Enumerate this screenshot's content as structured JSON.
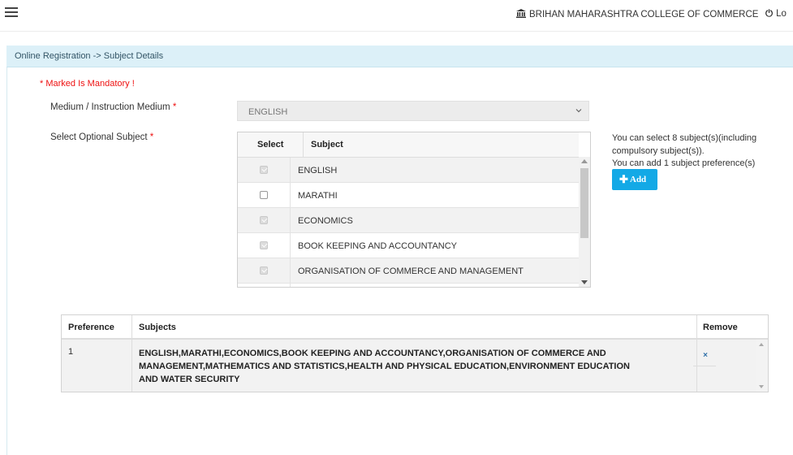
{
  "header": {
    "college_name": "BRIHAN MAHARASHTRA COLLEGE OF COMMERCE",
    "logout_label": "Lo",
    "college_icon": "bank-icon",
    "logout_icon": "power-icon",
    "menu_icon": "hamburger-icon"
  },
  "panel": {
    "breadcrumb": "Online Registration -> Subject Details"
  },
  "form": {
    "mandatory_note": "* Marked Is Mandatory !",
    "medium_label": "Medium / Instruction Medium",
    "medium_value": "ENGLISH",
    "optional_label": "Select Optional Subject",
    "required_mark": "*"
  },
  "subject_table": {
    "headers": [
      "Select",
      "Subject"
    ],
    "rows": [
      {
        "subject": "ENGLISH",
        "checked": true,
        "disabled": true
      },
      {
        "subject": "MARATHI",
        "checked": false,
        "disabled": false
      },
      {
        "subject": "ECONOMICS",
        "checked": true,
        "disabled": true
      },
      {
        "subject": "BOOK KEEPING AND ACCOUNTANCY",
        "checked": true,
        "disabled": true
      },
      {
        "subject": "ORGANISATION OF COMMERCE AND MANAGEMENT",
        "checked": true,
        "disabled": true
      }
    ]
  },
  "info": {
    "line1": "You can select 8 subject(s)(including",
    "line2": "compulsory subject(s)).",
    "line3": "You can add 1 subject preference(s)",
    "add_label": "Add"
  },
  "preference_table": {
    "headers": [
      "Preference",
      "Subjects",
      "Remove"
    ],
    "rows": [
      {
        "preference": "1",
        "subjects_line1": "ENGLISH,MARATHI,ECONOMICS,BOOK KEEPING AND ACCOUNTANCY,ORGANISATION OF COMMERCE AND",
        "subjects_line2": "MANAGEMENT,MATHEMATICS AND STATISTICS,HEALTH AND PHYSICAL EDUCATION,ENVIRONMENT EDUCATION",
        "subjects_line3": "AND WATER SECURITY",
        "remove_symbol": "×"
      }
    ]
  },
  "colors": {
    "panel_header_bg": "#dcf0f8",
    "add_button": "#13a9e6",
    "required": "#ee1111"
  }
}
